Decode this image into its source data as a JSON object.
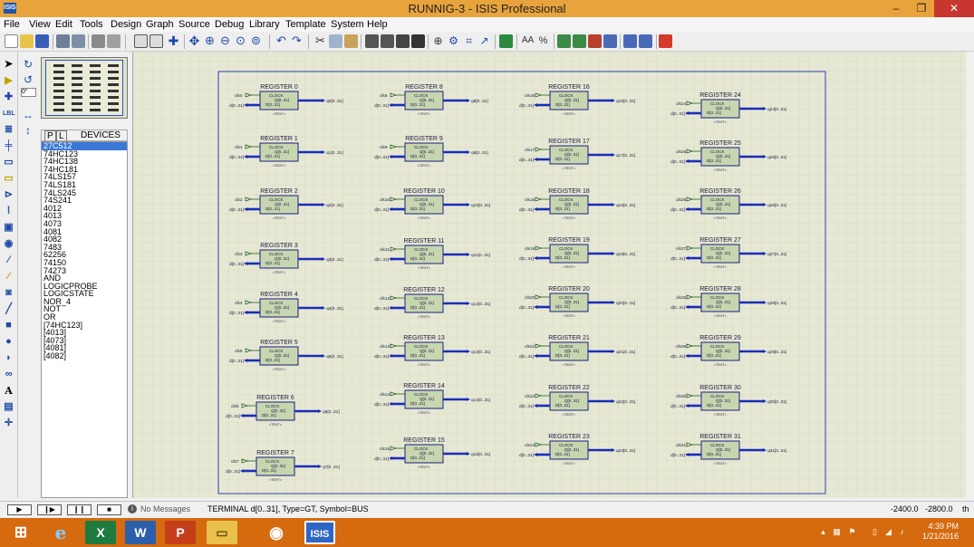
{
  "window": {
    "title": "RUNNIG-3 - ISIS Professional",
    "app_icon_text": "ISIS",
    "minimize": "–",
    "maximize": "❐",
    "close": "✕"
  },
  "menu": [
    "File",
    "View",
    "Edit",
    "Tools",
    "Design",
    "Graph",
    "Source",
    "Debug",
    "Library",
    "Template",
    "System",
    "Help"
  ],
  "left_panel": {
    "rotation_value": "0°",
    "pick_p": "P",
    "pick_l": "L",
    "devices_header": "DEVICES",
    "devices": [
      "27C512",
      "74HC123",
      "74HC138",
      "74HC181",
      "74LS157",
      "74LS181",
      "74LS245",
      "74S241",
      "4012",
      "4013",
      "4073",
      "4081",
      "4082",
      "7483",
      "62256",
      "74150",
      "74273",
      "AND",
      "LOGICPROBE",
      "LOGICSTATE",
      "NOR_4",
      "NOT",
      "OR",
      "[74HC123]",
      "[4013]",
      "[4073]",
      "[4081]",
      "[4082]"
    ],
    "selected_device": "27C512"
  },
  "schematic": {
    "registers": [
      {
        "title": "REGISTER 0",
        "clk": "clk0",
        "q": "q0[0..31]",
        "d": "d[0..31]"
      },
      {
        "title": "REGISTER 1",
        "clk": "clk1",
        "q": "q1[0..31]",
        "d": "d[0..31]"
      },
      {
        "title": "REGISTER 2",
        "clk": "clk2",
        "q": "q2[0..31]",
        "d": "d[0..31]"
      },
      {
        "title": "REGISTER 3",
        "clk": "clk3",
        "q": "q3[0..31]",
        "d": "d[0..31]"
      },
      {
        "title": "REGISTER 4",
        "clk": "clk4",
        "q": "q4[0..31]",
        "d": "d[0..31]"
      },
      {
        "title": "REGISTER 5",
        "clk": "clk5",
        "q": "q5[0..31]",
        "d": "d[0..31]"
      },
      {
        "title": "REGISTER 6",
        "clk": "clk6",
        "q": "q6[0..31]",
        "d": "d[0..31]"
      },
      {
        "title": "REGISTER 7",
        "clk": "clk7",
        "q": "q7[0..31]",
        "d": "d[0..31]"
      },
      {
        "title": "REGISTER 8",
        "clk": "clk8",
        "q": "q8[0..31]",
        "d": "d[0..31]"
      },
      {
        "title": "REGISTER 9",
        "clk": "clk9",
        "q": "q9[0..31]",
        "d": "d[0..31]"
      },
      {
        "title": "REGISTER 10",
        "clk": "clk10",
        "q": "q10[0..31]",
        "d": "d[0..31]"
      },
      {
        "title": "REGISTER 11",
        "clk": "clk11",
        "q": "q11[0..31]",
        "d": "d[0..31]"
      },
      {
        "title": "REGISTER 12",
        "clk": "clk12",
        "q": "q12[0..31]",
        "d": "d[0..31]"
      },
      {
        "title": "REGISTER 13",
        "clk": "clk13",
        "q": "q13[0..31]",
        "d": "d[0..31]"
      },
      {
        "title": "REGISTER 14",
        "clk": "clk14",
        "q": "q14[0..31]",
        "d": "d[0..31]"
      },
      {
        "title": "REGISTER 15",
        "clk": "clk15",
        "q": "q15[0..31]",
        "d": "d[0..31]"
      },
      {
        "title": "REGISTER 16",
        "clk": "clk16",
        "q": "q16[0..31]",
        "d": "d[0..31]"
      },
      {
        "title": "REGISTER 17",
        "clk": "clk17",
        "q": "q17[0..31]",
        "d": "d[0..31]"
      },
      {
        "title": "REGISTER 18",
        "clk": "clk18",
        "q": "q18[0..31]",
        "d": "d[0..31]"
      },
      {
        "title": "REGISTER 19",
        "clk": "clk19",
        "q": "q19[0..31]",
        "d": "d[0..31]"
      },
      {
        "title": "REGISTER 20",
        "clk": "clk20",
        "q": "q20[0..31]",
        "d": "d[0..31]"
      },
      {
        "title": "REGISTER 21",
        "clk": "clk21",
        "q": "q21[0..31]",
        "d": "d[0..31]"
      },
      {
        "title": "REGISTER 22",
        "clk": "clk22",
        "q": "q22[0..31]",
        "d": "d[0..31]"
      },
      {
        "title": "REGISTER 23",
        "clk": "clk23",
        "q": "q23[0..31]",
        "d": "d[0..31]"
      },
      {
        "title": "REGISTER 24",
        "clk": "clk24",
        "q": "q24[0..31]",
        "d": "d[0..31]"
      },
      {
        "title": "REGISTER 25",
        "clk": "clk25",
        "q": "q25[0..31]",
        "d": "d[0..31]"
      },
      {
        "title": "REGISTER 26",
        "clk": "clk26",
        "q": "q26[0..31]",
        "d": "d[0..31]"
      },
      {
        "title": "REGISTER 27",
        "clk": "clk27",
        "q": "q27[0..31]",
        "d": "d[0..31]"
      },
      {
        "title": "REGISTER 28",
        "clk": "clk28",
        "q": "q28[0..31]",
        "d": "d[0..31]"
      },
      {
        "title": "REGISTER 29",
        "clk": "clk29",
        "q": "q29[0..31]",
        "d": "d[0..31]"
      },
      {
        "title": "REGISTER 30",
        "clk": "clk30",
        "q": "q30[0..31]",
        "d": "d[0..31]"
      },
      {
        "title": "REGISTER 31",
        "clk": "clk31",
        "q": "q31[0..31]",
        "d": "d[0..31]"
      }
    ],
    "pin_clock": "CLOCK",
    "pin_q": "Q[0..31]",
    "pin_d": "D[0..31]",
    "footer": "<TEXT>",
    "colors": {
      "bus": "#1a2db8",
      "chip_fill": "#c8d6b0",
      "chip_border": "#1a2080",
      "sheet_border": "#3040c0",
      "canvas_bg": "#e7e8d4",
      "grid": "#d2d4bc"
    }
  },
  "status": {
    "play": "▶",
    "step": "❙▶",
    "pause": "❙❙",
    "stop": "■",
    "messages": "No Messages",
    "info": "TERMINAL d[0..31], Type=GT, Symbol=BUS",
    "coord_x": "-2400.0",
    "coord_y": "-2800.0",
    "coord_unit": "th"
  },
  "taskbar": {
    "time": "4:39 PM",
    "date": "1/21/2016",
    "apps": [
      "windows-start",
      "internet-explorer",
      "excel",
      "word",
      "powerpoint",
      "file-explorer",
      "chrome",
      "isis"
    ]
  }
}
